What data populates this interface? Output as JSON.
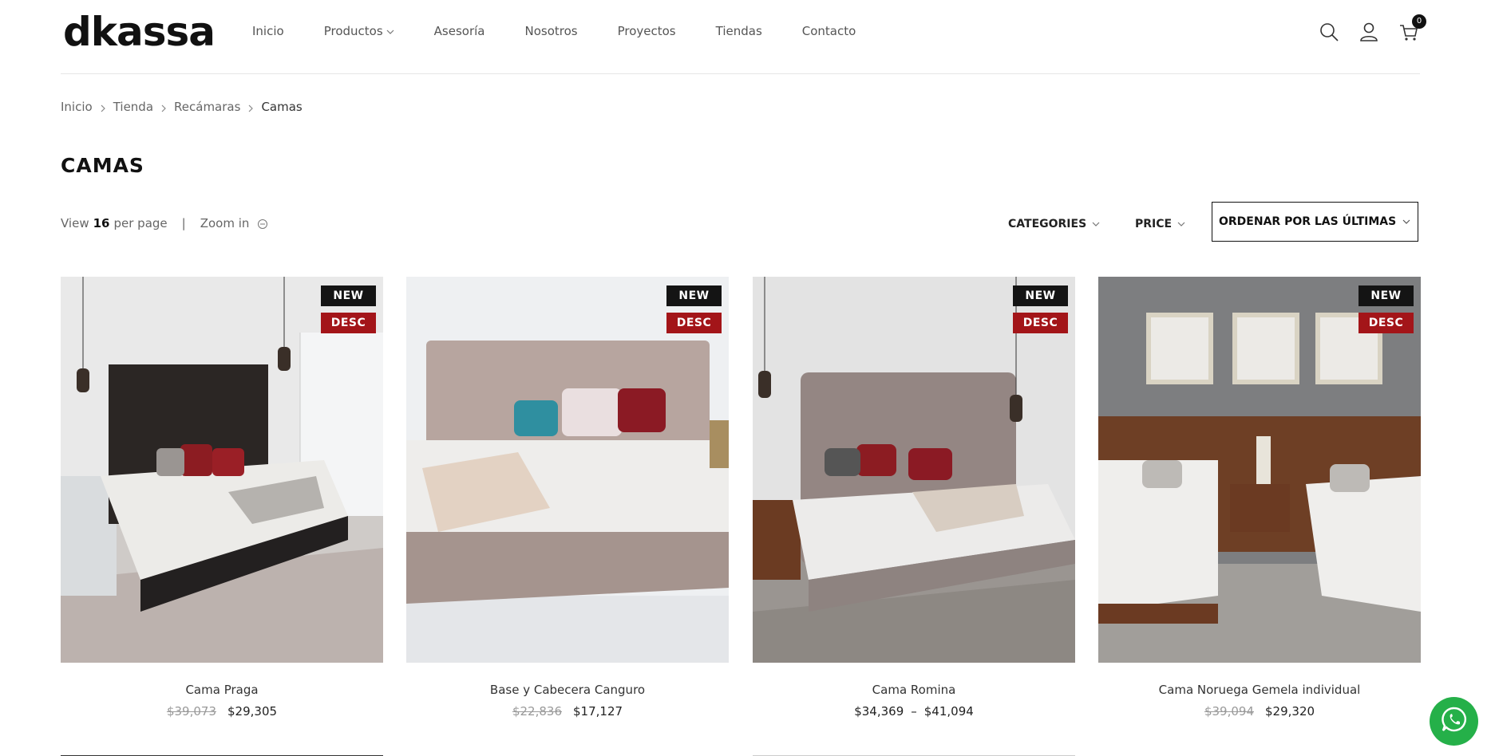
{
  "header": {
    "logo": "dkassa",
    "nav": [
      {
        "label": "Inicio"
      },
      {
        "label": "Productos"
      },
      {
        "label": "Asesoría"
      },
      {
        "label": "Nosotros"
      },
      {
        "label": "Proyectos"
      },
      {
        "label": "Tiendas"
      },
      {
        "label": "Contacto"
      }
    ],
    "cart_count": "0",
    "icons": [
      "search-icon",
      "user-icon",
      "cart-icon"
    ]
  },
  "breadcrumb": [
    "Inicio",
    "Tienda",
    "Recámaras",
    "Camas"
  ],
  "page_title": "CAMAS",
  "toolbar": {
    "view_label": "View",
    "view_count": "16",
    "per_page": "per page",
    "separator": "|",
    "zoom_label": "Zoom in",
    "categories": "CATEGORIES",
    "price": "PRICE",
    "sort": "ORDENAR POR LAS ÚLTIMAS"
  },
  "products": [
    {
      "name": "Cama Praga",
      "old_price": "$39,073",
      "price": "$29,305",
      "badge_new": "NEW",
      "badge_desc": "DESC"
    },
    {
      "name": "Base y Cabecera Canguro",
      "old_price": "$22,836",
      "price": "$17,127",
      "badge_new": "NEW",
      "badge_desc": "DESC"
    },
    {
      "name": "Cama Romina",
      "price_min": "$34,369",
      "price_sep": "–",
      "price_max": "$41,094",
      "badge_new": "NEW",
      "badge_desc": "DESC"
    },
    {
      "name": "Cama Noruega Gemela individual",
      "old_price": "$39,094",
      "price": "$29,320",
      "badge_new": "NEW",
      "badge_desc": "DESC"
    }
  ],
  "colors": {
    "badge_new": "#141414",
    "badge_desc": "#a31519",
    "whatsapp": "#25b049"
  }
}
